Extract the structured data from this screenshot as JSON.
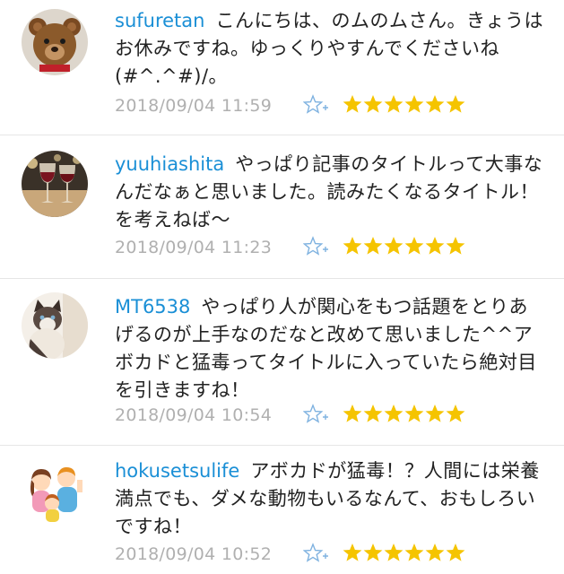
{
  "comments": [
    {
      "username": "sufuretan",
      "text": "こんにちは、のムのムさん。きょうはお休みですね。ゆっくりやすんでくださいね(#^.^#)/。",
      "timestamp": "2018/09/04 11:59",
      "stars": 6,
      "avatar": "teddy-bear"
    },
    {
      "username": "yuuhiashita",
      "text": "やっぱり記事のタイトルって大事なんだなぁと思いました。読みたくなるタイトル！を考えねば〜",
      "timestamp": "2018/09/04 11:23",
      "stars": 6,
      "avatar": "wine-glasses"
    },
    {
      "username": "MT6538",
      "text": "やっぱり人が関心をもつ話題をとりあげるのが上手なのだなと改めて思いました^^アボカドと猛毒ってタイトルに入っていたら絶対目を引きますね！",
      "timestamp": "2018/09/04 10:54",
      "stars": 6,
      "avatar": "cat"
    },
    {
      "username": "hokusetsulife",
      "text": "アボカドが猛毒！？人間には栄養満点でも、ダメな動物もいるなんて、おもしろいですね！",
      "timestamp": "2018/09/04 10:52",
      "stars": 6,
      "avatar": "family-illustration"
    }
  ],
  "colors": {
    "username": "#1a8fd6",
    "timestamp": "#b0b0b0",
    "star": "#f5c400",
    "add_star": "#7fb2e0"
  }
}
